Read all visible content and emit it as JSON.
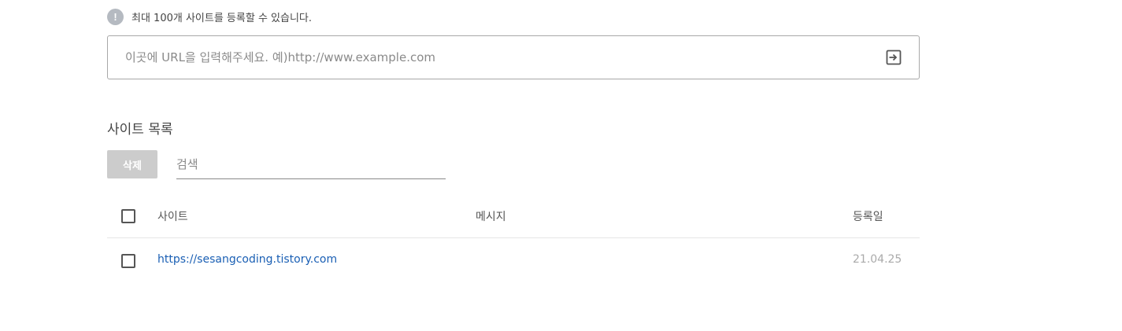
{
  "notice": {
    "icon": "exclamation-icon",
    "icon_glyph": "!",
    "text": "최대 100개 사이트를 등록할 수 있습니다."
  },
  "url_input": {
    "placeholder": "이곳에 URL을 입력해주세요. 예)http://www.example.com",
    "value": "",
    "submit_icon": "enter-icon"
  },
  "site_list": {
    "title": "사이트 목록",
    "delete_label": "삭제",
    "search_placeholder": "검색",
    "columns": {
      "site": "사이트",
      "message": "메시지",
      "date": "등록일"
    },
    "rows": [
      {
        "site": "https://sesangcoding.tistory.com",
        "message": "",
        "date": "21.04.25",
        "checked": false
      }
    ]
  },
  "colors": {
    "link": "#1a5fb4",
    "button_disabled": "#cccccc",
    "notice_icon": "#b5bac1"
  }
}
